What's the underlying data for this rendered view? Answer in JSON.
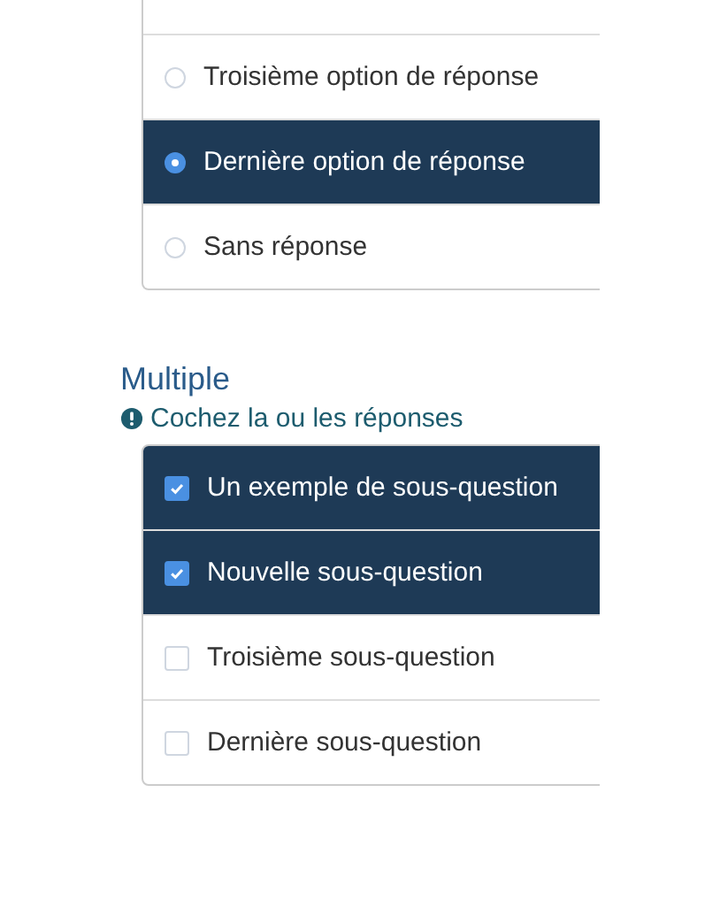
{
  "single": {
    "options": [
      {
        "label": "Troisième option de réponse",
        "selected": false
      },
      {
        "label": "Dernière option de réponse",
        "selected": true
      },
      {
        "label": "Sans réponse",
        "selected": false
      }
    ]
  },
  "multiple": {
    "title": "Multiple",
    "hint": "Cochez la ou les réponses",
    "items": [
      {
        "label": "Un exemple de sous-question",
        "checked": true
      },
      {
        "label": "Nouvelle sous-question",
        "checked": true
      },
      {
        "label": "Troisième sous-question",
        "checked": false
      },
      {
        "label": "Dernière sous-question",
        "checked": false
      }
    ]
  }
}
